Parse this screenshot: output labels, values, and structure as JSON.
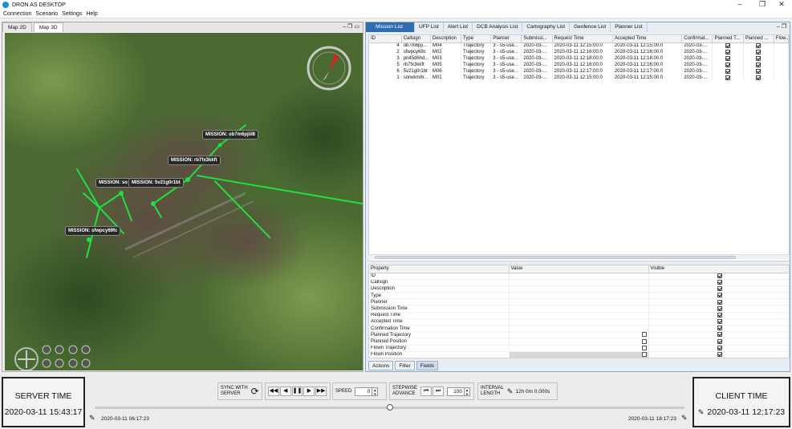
{
  "app": {
    "title": "DRON AS DESKTOP"
  },
  "window_controls": {
    "minimize": "–",
    "maximize": "❐",
    "close": "✕"
  },
  "menu": [
    "Connection",
    "Scenario",
    "Settings",
    "Help"
  ],
  "map_panel": {
    "tabs": [
      "Map 2D",
      "Map 3D"
    ],
    "active_tab": "Map 3D",
    "labels": [
      "MISSION: ob7m6pjiil8",
      "MISSION: rb7fx3kkft",
      "MISSION: so",
      "MISSION: 5v21g0r1bt",
      "MISSION: sfwpcy69fc"
    ],
    "route_color": "#20e040"
  },
  "right_panel": {
    "tabs": [
      "Mission List",
      "UFP List",
      "Alert List",
      "DCB Analysis List",
      "Cartography List",
      "Geofence List",
      "Planner List"
    ],
    "active_tab": "Mission List",
    "table": {
      "columns": [
        "ID",
        "Callsign",
        "Description",
        "Type",
        "Planner",
        "Submissi...",
        "Request Time",
        "Accepted Time",
        "Confirmat...",
        "Planned T...",
        "Planned ...",
        "Flow..."
      ],
      "rows": [
        {
          "id": "4",
          "callsign": "ob7m6pji...",
          "description": "M04",
          "type": "Trajectory",
          "planner": "3 - s5-use...",
          "submission": "2020-03-...",
          "request": "2020-03-11 12:15:00.0",
          "accepted": "2020-03-11 12:15:00.0",
          "confirmation": "2020-03-...",
          "pt": true,
          "pp": true
        },
        {
          "id": "2",
          "callsign": "sfwpcy69c",
          "description": "M02",
          "type": "Trajectory",
          "planner": "3 - s5-use...",
          "submission": "2020-03-...",
          "request": "2020-03-11 12:16:00.0",
          "accepted": "2020-03-11 12:16:00.0",
          "confirmation": "2020-03-...",
          "pt": true,
          "pp": true
        },
        {
          "id": "3",
          "callsign": "pn45d6hd...",
          "description": "M03",
          "type": "Trajectory",
          "planner": "3 - s5-use...",
          "submission": "2020-03-...",
          "request": "2020-03-11 12:18:00.0",
          "accepted": "2020-03-11 12:18:00.0",
          "confirmation": "2020-03-...",
          "pt": true,
          "pp": true
        },
        {
          "id": "5",
          "callsign": "rb7fx3kkft",
          "description": "M05",
          "type": "Trajectory",
          "planner": "3 - s5-use...",
          "submission": "2020-03-...",
          "request": "2020-03-11 12:16:00.0",
          "accepted": "2020-03-11 12:16:00.0",
          "confirmation": "2020-03-...",
          "pt": true,
          "pp": true
        },
        {
          "id": "6",
          "callsign": "5v21g0r1bt",
          "description": "M06",
          "type": "Trajectory",
          "planner": "3 - s5-use...",
          "submission": "2020-03-...",
          "request": "2020-03-11 12:17:00.0",
          "accepted": "2020-03-11 12:17:00.0",
          "confirmation": "2020-03-...",
          "pt": true,
          "pp": true
        },
        {
          "id": "1",
          "callsign": "sorwkm8r...",
          "description": "M01",
          "type": "Trajectory",
          "planner": "3 - s5-use...",
          "submission": "2020-03-...",
          "request": "2020-03-11 12:15:00.0",
          "accepted": "2020-03-11 12:15:00.0",
          "confirmation": "2020-03-...",
          "pt": true,
          "pp": true
        }
      ]
    },
    "properties": {
      "columns": [
        "Property",
        "Value",
        "Visible"
      ],
      "rows": [
        {
          "name": "ID",
          "has_value_checkbox": false,
          "visible": true
        },
        {
          "name": "Callsign",
          "has_value_checkbox": false,
          "visible": true
        },
        {
          "name": "Description",
          "has_value_checkbox": false,
          "visible": true
        },
        {
          "name": "Type",
          "has_value_checkbox": false,
          "visible": true
        },
        {
          "name": "Planner",
          "has_value_checkbox": false,
          "visible": true
        },
        {
          "name": "Submission Time",
          "has_value_checkbox": false,
          "visible": true
        },
        {
          "name": "Request Time",
          "has_value_checkbox": false,
          "visible": true
        },
        {
          "name": "Accepted Time",
          "has_value_checkbox": false,
          "visible": true
        },
        {
          "name": "Confirmation Time",
          "has_value_checkbox": false,
          "visible": true
        },
        {
          "name": "Planned Trajectory",
          "has_value_checkbox": true,
          "visible": true
        },
        {
          "name": "Planned Position",
          "has_value_checkbox": true,
          "visible": true
        },
        {
          "name": "Flown Trajectory",
          "has_value_checkbox": true,
          "visible": true
        },
        {
          "name": "Flown Position",
          "has_value_checkbox": true,
          "visible": true
        }
      ]
    },
    "bottom_tabs": [
      "Actions",
      "Filter",
      "Fields"
    ],
    "active_bottom_tab": "Fields"
  },
  "bottom_bar": {
    "server_time_label": "SERVER TIME",
    "server_time_value": "2020-03-11 15:43:17",
    "client_time_label": "CLIENT TIME",
    "client_time_value": "2020-03-11 12:17:23",
    "sync_label_1": "SYNC WITH",
    "sync_label_2": "SERVER",
    "speed_label": "SPEED",
    "speed_value": "0",
    "stepwise_label_1": "STEPWISE",
    "stepwise_label_2": "ADVANCE",
    "stepwise_value": "100",
    "interval_label_1": "INTERVAL",
    "interval_label_2": "LENGTH",
    "interval_value": "12h 0m 0.000s",
    "timeline_start": "2020-03-11 06:17:23",
    "timeline_end": "2020-03-11 18:17:23",
    "timeline_position": 0.5
  }
}
